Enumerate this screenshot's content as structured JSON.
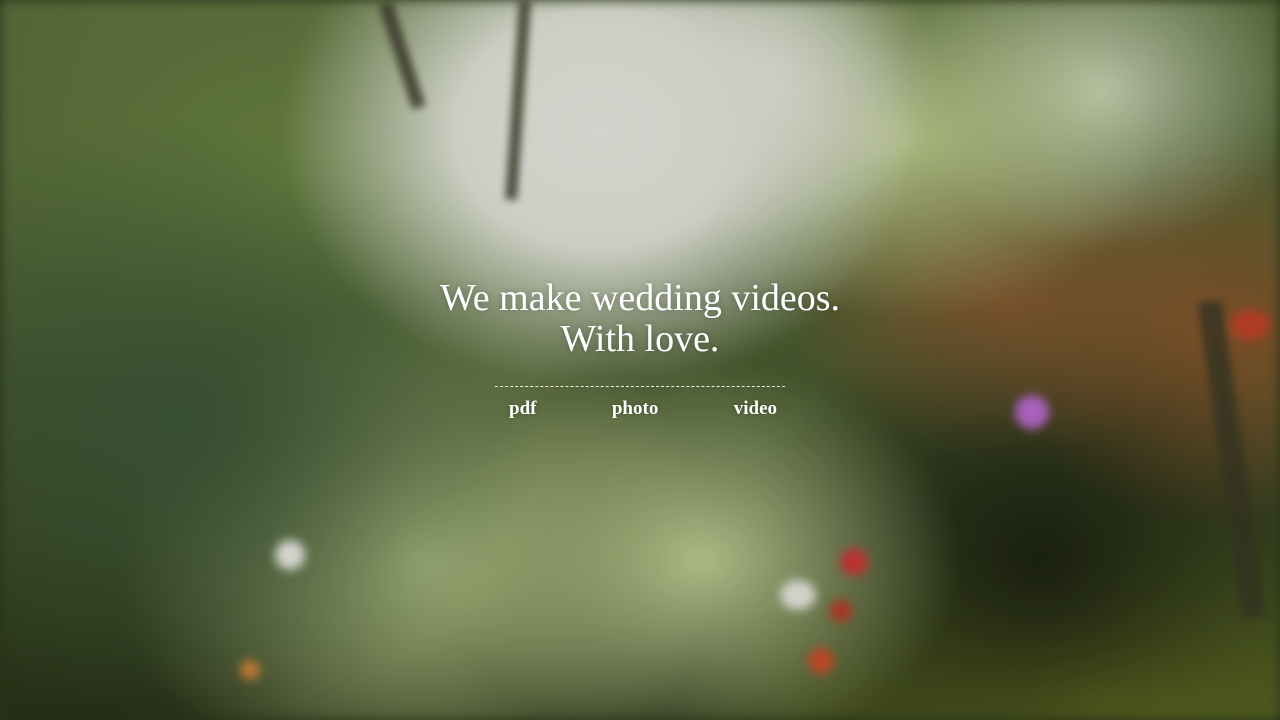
{
  "hero": {
    "headline_line1": "We make wedding videos.",
    "headline_line2": "With love."
  },
  "nav": {
    "items": [
      {
        "label": "pdf"
      },
      {
        "label": "photo"
      },
      {
        "label": "video"
      }
    ]
  },
  "colors": {
    "text": "#ffffff",
    "background_theme": "blurred garden (greens, whites, reds)"
  }
}
